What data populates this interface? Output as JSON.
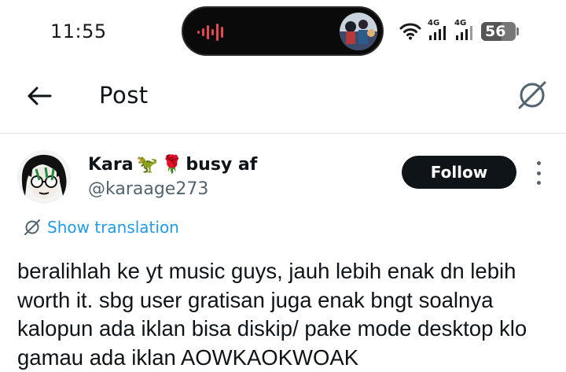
{
  "status_bar": {
    "time": "11:55",
    "network_1": "4G",
    "network_2": "4G",
    "battery": "56"
  },
  "header": {
    "title": "Post"
  },
  "tweet": {
    "display_name": "Kara",
    "name_emojis": [
      "🦖",
      "🌹"
    ],
    "name_suffix": "busy af",
    "handle": "@karaage273",
    "follow_label": "Follow",
    "show_translation_label": "Show translation",
    "text": "beralihlah ke yt music guys, jauh lebih enak dn lebih worth it. sbg user gratisan juga enak bngt soalnya kalopun ada iklan bisa diskip/ pake mode desktop klo gamau ada iklan AOWKAOKWOAK"
  },
  "colors": {
    "accent": "#1d9bf0",
    "text_primary": "#0f1419",
    "text_secondary": "#536471",
    "follow_bg": "#0f1419",
    "waveform": "#e5484d"
  },
  "icons": {
    "back": "arrow-left-icon",
    "translate": "translate-icon",
    "more": "more-vertical-icon",
    "wifi": "wifi-icon",
    "signal": "signal-icon",
    "battery": "battery-icon",
    "waveform": "audio-waveform-icon"
  }
}
